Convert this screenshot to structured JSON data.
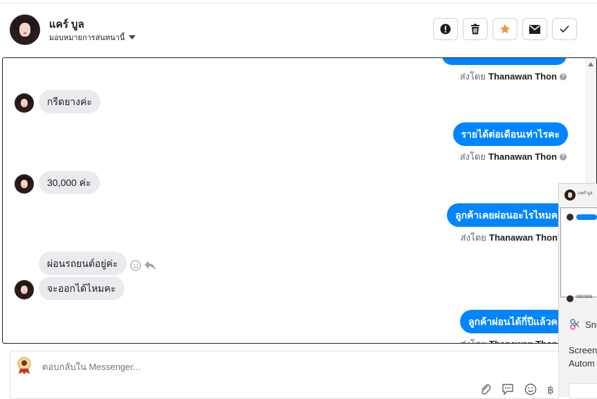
{
  "header": {
    "contact_name": "แคร์ บูล",
    "assign_label": "มอบหมายการสนทนานี้",
    "actions": [
      {
        "name": "report",
        "icon": "alert-circle-icon"
      },
      {
        "name": "delete",
        "icon": "trash-icon"
      },
      {
        "name": "star",
        "icon": "star-icon"
      },
      {
        "name": "mark-unread",
        "icon": "envelope-icon"
      },
      {
        "name": "done",
        "icon": "check-icon"
      }
    ],
    "star_color": "#f7923a"
  },
  "chat": {
    "sent_by_prefix": "ส่งโดย",
    "agent_name": "Thanawan Thon",
    "outgoing_color": "#0084ff",
    "messages": [
      {
        "dir": "out",
        "text": "รายได้ต่อเดือนเท่าไรคะ"
      },
      {
        "dir": "in",
        "text": "กรีดยางค่ะ"
      },
      {
        "dir": "in",
        "text": "30,000 ค่ะ"
      },
      {
        "dir": "out",
        "text": "ลูกค้าเคยผ่อนอะไรไหมคะ"
      },
      {
        "dir": "in",
        "text": "ผ่อนรถยนต์อยู่ค่ะ"
      },
      {
        "dir": "in",
        "text": "จะออกได้ไหมคะ"
      },
      {
        "dir": "out",
        "text": "ลูกค้าผ่อนได้กี่ปีแล้วคะ"
      }
    ]
  },
  "overlay": {
    "title": "Sni",
    "line1": "Screen",
    "line2": "Autom",
    "mini_name": "แคร์ บูล",
    "mini_phone": "0902909"
  },
  "reply": {
    "placeholder": "ตอบกลับใน Messenger..."
  }
}
